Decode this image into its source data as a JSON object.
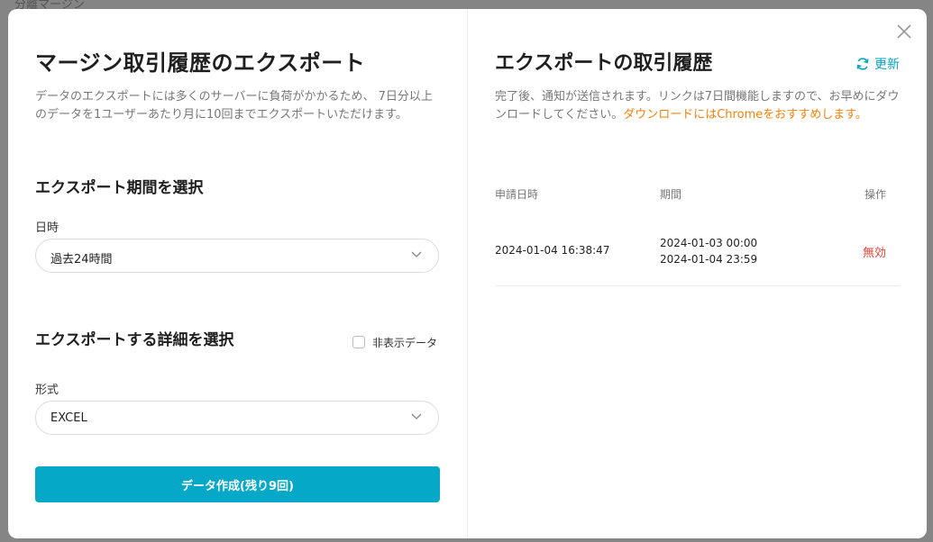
{
  "background": {
    "text": "分離マージン"
  },
  "left": {
    "title": "マージン取引履歴のエクスポート",
    "description": "データのエクスポートには多くのサーバーに負荷がかかるため、 7日分以上のデータを1ユーザーあたり月に10回までエクスポートいただけます。",
    "period_section": "エクスポート期間を選択",
    "date_label": "日時",
    "date_value": "過去24時間",
    "detail_section": "エクスポートする詳細を選択",
    "hidden_data_label": "非表示データ",
    "hidden_data_checked": false,
    "format_label": "形式",
    "format_value": "EXCEL",
    "submit_label": "データ作成(残り9回)"
  },
  "right": {
    "title": "エクスポートの取引履歴",
    "refresh_label": "更新",
    "description": "完了後、通知が送信されます。リンクは7日間機能しますので、お早めにダウンロードしてください。",
    "description_highlight": "ダウンロードにはChromeをおすすめします。",
    "columns": [
      "申請日時",
      "期間",
      "操作"
    ],
    "rows": [
      {
        "requested": "2024-01-04 16:38:47",
        "period_start": "2024-01-03 00:00",
        "period_end": "2024-01-04 23:59",
        "action": "無効"
      }
    ]
  },
  "colors": {
    "accent": "#06a8c8",
    "highlight": "#f2810f",
    "invalid": "#e0463a"
  },
  "icons": [
    "close-icon",
    "refresh-icon",
    "chevron-down-icon",
    "checkbox-icon"
  ]
}
